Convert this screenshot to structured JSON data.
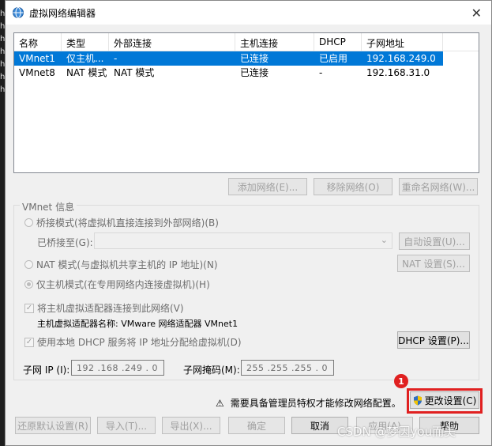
{
  "edge_letters": [
    "h",
    "h",
    "h",
    "h",
    "h",
    "h",
    "h"
  ],
  "window": {
    "title": "虚拟网络编辑器",
    "close_glyph": "✕"
  },
  "table": {
    "columns": [
      "名称",
      "类型",
      "外部连接",
      "主机连接",
      "DHCP",
      "子网地址"
    ],
    "rows": [
      {
        "name": "VMnet1",
        "type": "仅主机...",
        "external": "-",
        "host": "已连接",
        "dhcp": "已启用",
        "subnet": "192.168.249.0",
        "selected": true
      },
      {
        "name": "VMnet8",
        "type": "NAT 模式",
        "external": "NAT 模式",
        "host": "已连接",
        "dhcp": "-",
        "subnet": "192.168.31.0",
        "selected": false
      }
    ]
  },
  "list_buttons": {
    "add": "添加网络(E)...",
    "remove": "移除网络(O)",
    "rename": "重命名网络(W)..."
  },
  "vmnet_info": {
    "group_label": "VMnet 信息",
    "bridged_radio": "桥接模式(将虚拟机直接连接到外部网络)(B)",
    "bridged_to_label": "已桥接至(G):",
    "auto_settings": "自动设置(U)...",
    "nat_radio": "NAT 模式(与虚拟机共享主机的 IP 地址)(N)",
    "nat_settings": "NAT 设置(S)...",
    "hostonly_radio": "仅主机模式(在专用网络内连接虚拟机)(H)",
    "connect_adapter_check": "将主机虚拟适配器连接到此网络(V)",
    "adapter_name": "主机虚拟适配器名称: VMware 网络适配器 VMnet1",
    "dhcp_check": "使用本地 DHCP 服务将 IP 地址分配给虚拟机(D)",
    "dhcp_settings": "DHCP 设置(P)...",
    "subnet_ip_label": "子网 IP (I):",
    "subnet_ip": "192 .168 .249 . 0",
    "subnet_mask_label": "子网掩码(M):",
    "subnet_mask": "255 .255 .255 . 0"
  },
  "admin": {
    "warning_glyph": "⚠",
    "message": "需要具备管理员特权才能修改网络配置。",
    "change_settings": "更改设置(C)",
    "badge": "1"
  },
  "bottom_buttons": {
    "restore": "还原默认设置(R)",
    "import": "导入(T)...",
    "export": "导出(X)...",
    "ok": "确定",
    "cancel": "取消",
    "apply": "应用(A)",
    "help": "帮助"
  },
  "watermark": "CSDN @梦因you而美",
  "colors": {
    "selection": "#0078d7",
    "highlight_box": "#e02020"
  }
}
